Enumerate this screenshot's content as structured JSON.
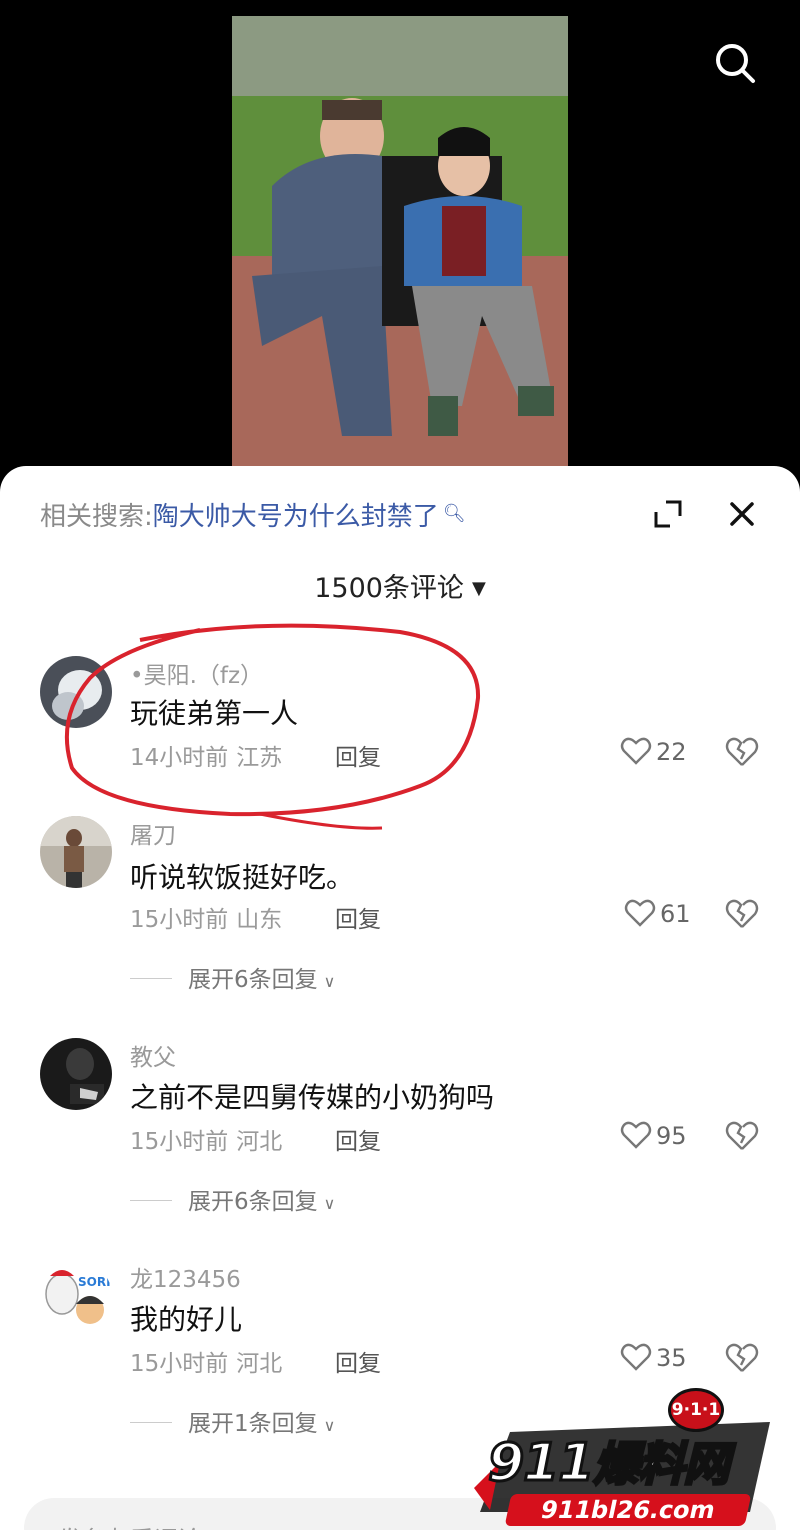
{
  "header": {
    "search_icon": "search-icon"
  },
  "related_search": {
    "label": "相关搜索:",
    "query": "陶大帅大号为什么封禁了",
    "query_icon": "search-icon"
  },
  "comment_count": "1500条评论",
  "comments": [
    {
      "username": "•昊阳.（fz）",
      "text": "玩徒弟第一人",
      "time": "14小时前",
      "location": "江苏",
      "reply_label": "回复",
      "likes": "22"
    },
    {
      "username": "屠刀",
      "text": "听说软饭挺好吃。",
      "time": "15小时前",
      "location": "山东",
      "reply_label": "回复",
      "likes": "61",
      "expand_label": "展开6条回复"
    },
    {
      "username": "教父",
      "text": "之前不是四舅传媒的小奶狗吗",
      "time": "15小时前",
      "location": "河北",
      "reply_label": "回复",
      "likes": "95",
      "expand_label": "展开6条回复"
    },
    {
      "username": "龙123456",
      "text": "我的好儿",
      "time": "15小时前",
      "location": "河北",
      "reply_label": "回复",
      "likes": "35",
      "expand_label": "展开1条回复"
    }
  ],
  "input": {
    "placeholder": "发条友爱评论"
  },
  "watermark": {
    "badge": "9·1·1",
    "logo_number": "911",
    "logo_text": "爆料网",
    "url": "911bl26.com"
  },
  "colors": {
    "accent_link": "#3b5aa6",
    "annotation_red": "#d9232d"
  }
}
